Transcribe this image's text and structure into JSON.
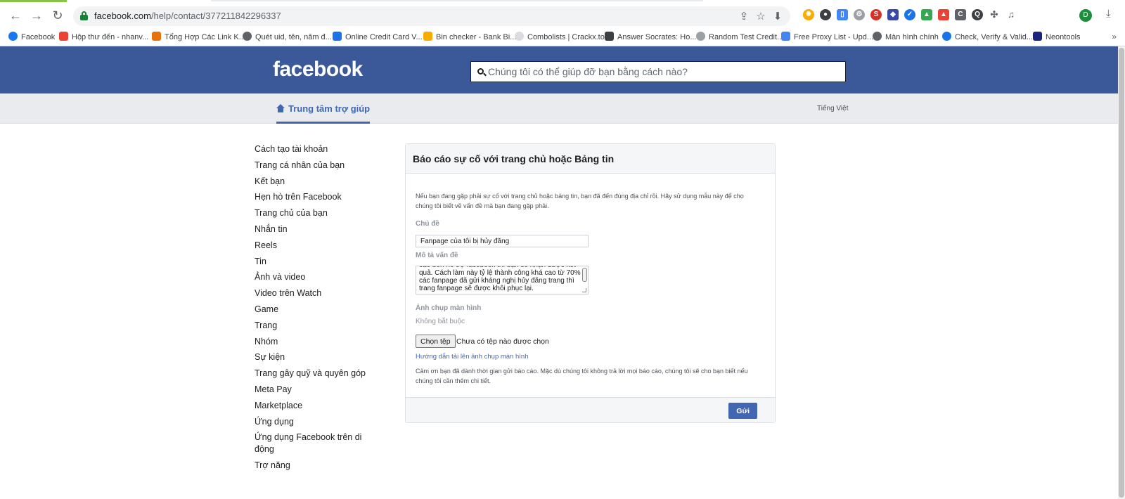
{
  "browser": {
    "url_host": "facebook.com",
    "url_path": "/help/contact/377211842296337",
    "avatar_letter": "D",
    "bookmarks": [
      {
        "label": "Facebook",
        "color": "#1877f2"
      },
      {
        "label": "Hộp thư đến - nhanv...",
        "color": "#ea4335"
      },
      {
        "label": "Tổng Hợp Các Link K...",
        "color": "#e8710a"
      },
      {
        "label": "Quét uid, tên, năm đ...",
        "color": "#5f6368"
      },
      {
        "label": "Online Credit Card V...",
        "color": "#1a73e8"
      },
      {
        "label": "Bin checker - Bank Bi...",
        "color": "#f9ab00"
      },
      {
        "label": "Combolists | Crackx.to",
        "color": "#dadce0"
      },
      {
        "label": "Answer Socrates: Ho...",
        "color": "#3c4043"
      },
      {
        "label": "Random Test Credit...",
        "color": "#9aa0a6"
      },
      {
        "label": "Free Proxy List - Upd...",
        "color": "#4285f4"
      },
      {
        "label": "Màn hình chính",
        "color": "#5f6368"
      },
      {
        "label": "Check, Verify & Valid...",
        "color": "#1a73e8"
      },
      {
        "label": "Neontools",
        "color": "#1a237e"
      }
    ],
    "more_bookmarks": "»"
  },
  "header": {
    "logo": "facebook",
    "search_placeholder": "Chúng tôi có thể giúp đỡ bạn bằng cách nào?"
  },
  "subnav": {
    "help_center": "Trung tâm trợ giúp",
    "language": "Tiếng Việt"
  },
  "sidebar": {
    "items": [
      "Cách tạo tài khoản",
      "Trang cá nhân của bạn",
      "Kết bạn",
      "Hẹn hò trên Facebook",
      "Trang chủ của bạn",
      "Nhắn tin",
      "Reels",
      "Tin",
      "Ảnh và video",
      "Video trên Watch",
      "Game",
      "Trang",
      "Nhóm",
      "Sự kiện",
      "Trang gây quỹ và quyên góp",
      "Meta Pay",
      "Marketplace",
      "Ứng dụng",
      "Ứng dụng Facebook trên di động",
      "Trợ năng"
    ]
  },
  "form": {
    "title": "Báo cáo sự cố với trang chủ hoặc Bảng tin",
    "intro": "Nếu bạn đang gặp phải sự cố với trang chủ hoặc bảng tin, bạn đã đến đúng địa chỉ rồi. Hãy sử dụng mẫu này để cho chúng tôi biết về vấn đề mà bạn đang gặp phải.",
    "subject_label": "Chủ đề",
    "subject_value": "Fanpage của tôi bị hủy đăng",
    "description_label": "Mô tả vấn đề",
    "description_value": "cao bên hỗ trợ facebook thì bạn sẽ nhận được kết quả. Cách làm này tỷ lệ thành công khá cao từ 70% các fanpage đã gửi kháng nghị hủy đăng trang thì trang fanpage sẽ được khôi phục lại.",
    "screenshot_label": "Ảnh chụp màn hình",
    "optional": "Không bắt buộc",
    "choose_file": "Chọn tệp",
    "no_file": "Chưa có tệp nào được chọn",
    "guide_link": "Hướng dẫn tải lên ảnh chụp màn hình",
    "thanks": "Cảm ơn bạn đã dành thời gian gửi báo cáo. Mặc dù chúng tôi không trả lời mọi báo cáo, chúng tôi sẽ cho bạn biết nếu chúng tôi cần thêm chi tiết.",
    "submit": "Gửi"
  },
  "colors": {
    "fb_blue": "#3b5998",
    "link_blue": "#4267b2",
    "subnav_bg": "#e9ebee"
  }
}
